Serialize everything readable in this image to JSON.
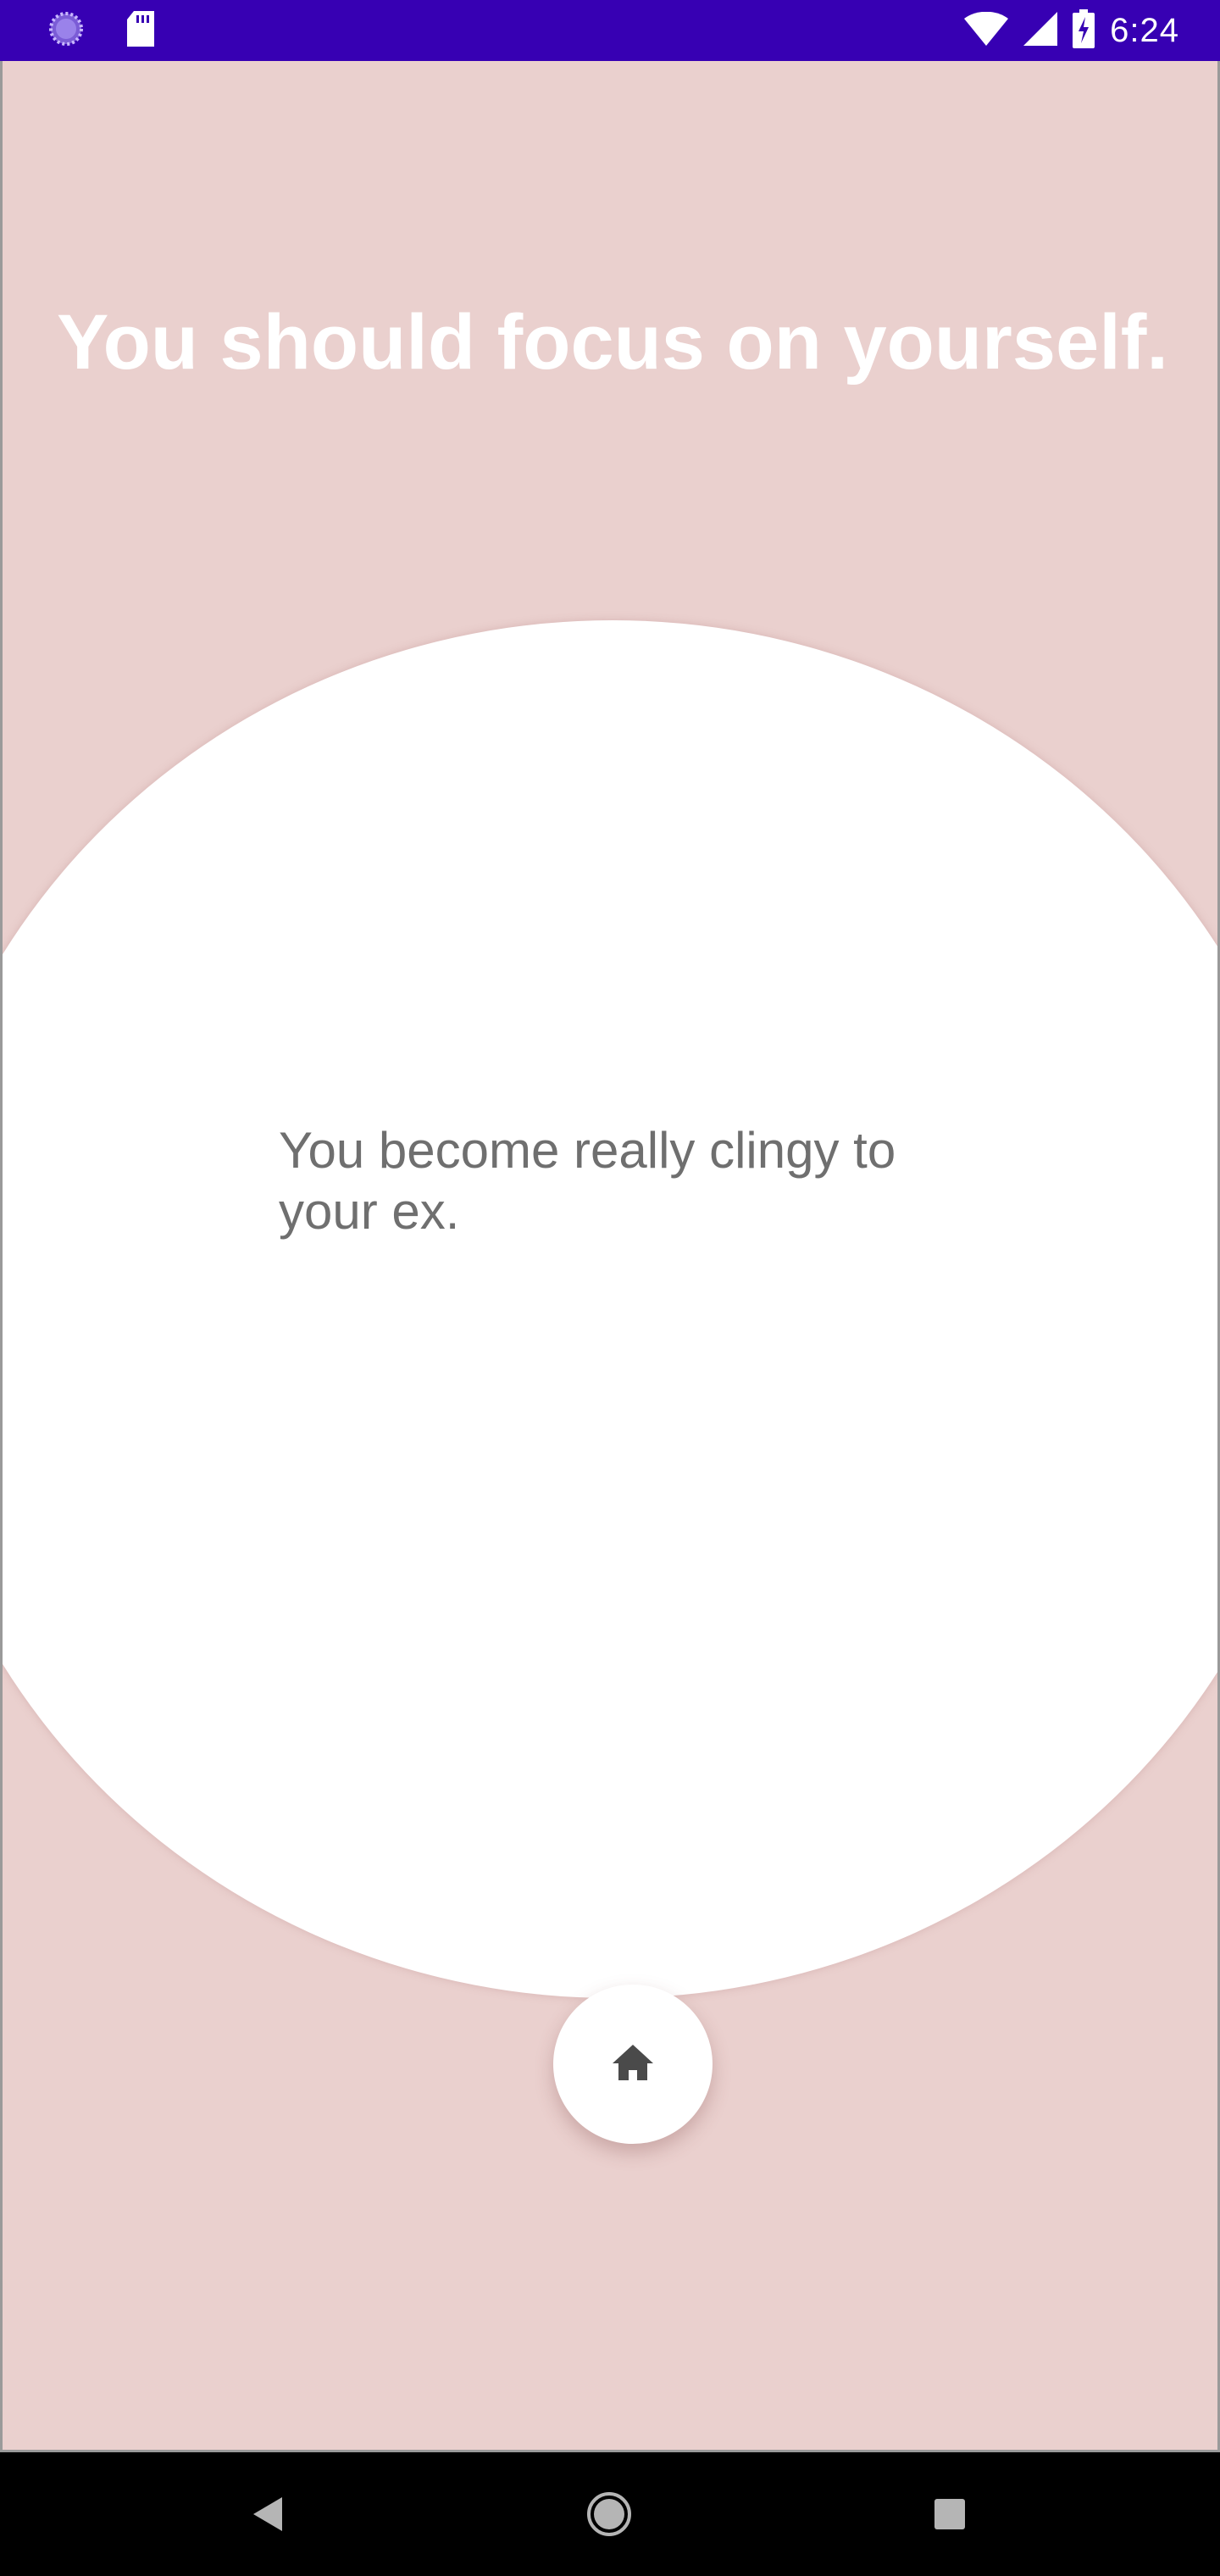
{
  "status_bar": {
    "time": "6:24",
    "icons": [
      "loading-circle-icon",
      "sd-card-icon",
      "wifi-icon",
      "cell-signal-icon",
      "battery-charging-icon"
    ]
  },
  "main": {
    "headline": "You should focus on yourself.",
    "card_text": "You become really clingy to your ex.",
    "home_button_icon": "home-icon"
  },
  "navigation": {
    "buttons": [
      "back-icon",
      "home-circle-icon",
      "recents-icon"
    ]
  },
  "colors": {
    "status_bar": "#3700b3",
    "background": "#ead0ce",
    "card": "#ffffff",
    "headline": "#ffffff",
    "body_text": "#6f6f6f",
    "nav_bar": "#000000"
  }
}
